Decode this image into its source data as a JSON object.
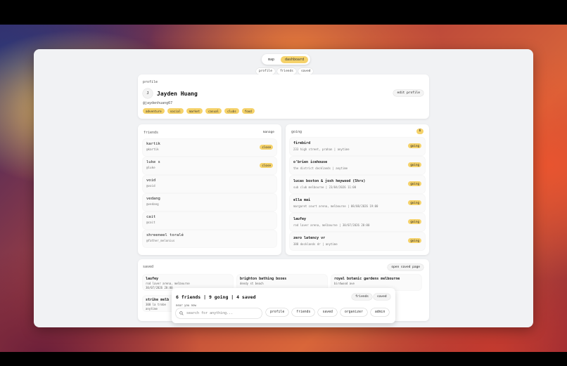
{
  "toggle": {
    "map": "map",
    "dashboard": "dashboard"
  },
  "subnav": [
    "profile",
    "friends",
    "saved"
  ],
  "profile": {
    "label": "profile",
    "avatar_initial": "J",
    "name": "Jayden Huang",
    "edit_label": "edit profile",
    "handle": "@jaydenhuang67",
    "tags": [
      "adventure",
      "social",
      "market",
      "casual",
      "clubs",
      "food"
    ]
  },
  "friends": {
    "label": "friends",
    "manage": "manage",
    "items": [
      {
        "name": "kartik",
        "handle": "@kartik",
        "badge": "close"
      },
      {
        "name": "luke s",
        "handle": "@luke",
        "badge": "close"
      },
      {
        "name": "void",
        "handle": "@void",
        "badge": ""
      },
      {
        "name": "vedang",
        "handle": "@vedang",
        "badge": ""
      },
      {
        "name": "cait",
        "handle": "@cait",
        "badge": ""
      },
      {
        "name": "shreeneel toralé",
        "handle": "@father_melonius",
        "badge": ""
      }
    ]
  },
  "going": {
    "label": "going",
    "count": "6",
    "items": [
      {
        "title": "firebird",
        "sub": "233 high street, prahan | anytime",
        "badge": "going"
      },
      {
        "title": "o'brien icehouse",
        "sub": "the district docklands | anytime",
        "badge": "going"
      },
      {
        "title": "lucas boston & josh heywood (5hrs)",
        "sub": "sub club melbourne | 23/04/2026 11:00",
        "badge": "going"
      },
      {
        "title": "ella mai",
        "sub": "margaret court arena, melbourne | 08/08/2026 19:00",
        "badge": "going"
      },
      {
        "title": "laufey",
        "sub": "rod laver arena, melbourne | 30/07/2026 20:00",
        "badge": "going"
      },
      {
        "title": "zero latency vr",
        "sub": "388 docklands dr | anytime",
        "badge": "going"
      }
    ]
  },
  "saved": {
    "label": "saved",
    "open_label": "open saved page",
    "items": [
      {
        "title": "laufey",
        "line1": "rod laver arena, melbourne",
        "line2": "30/07/2026 20:00"
      },
      {
        "title": "brighton bathing boxes",
        "line1": "dendy st beach",
        "line2": ""
      },
      {
        "title": "royal botanic gardens melbourne",
        "line1": "birdwood ave",
        "line2": ""
      },
      {
        "title": "strike melb",
        "line1": "300 la trobe",
        "line2": "anytime"
      }
    ]
  },
  "summary": {
    "text": "6 friends | 9 going | 4 saved",
    "friends_btn": "friends",
    "saved_btn": "saved",
    "near_label": "near you now",
    "search_placeholder": "search for anything...",
    "filters": [
      "profile",
      "friends",
      "saved",
      "organizer",
      "admin"
    ]
  }
}
